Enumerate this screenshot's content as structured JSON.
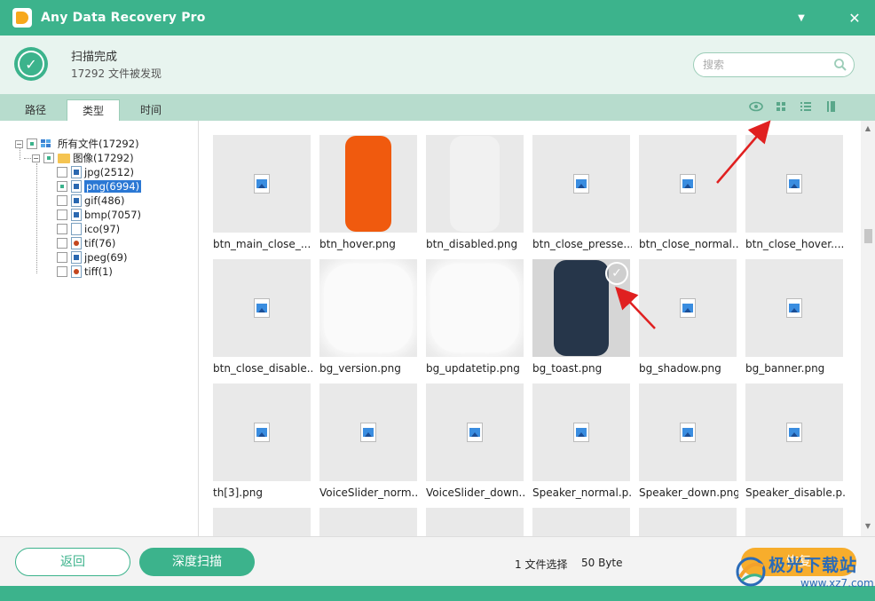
{
  "app": {
    "title": "Any Data Recovery Pro"
  },
  "scan": {
    "title": "扫描完成",
    "count": "17292 文件被发现"
  },
  "search": {
    "placeholder": "搜索",
    "value": ""
  },
  "tabs": [
    {
      "label": "路径"
    },
    {
      "label": "类型"
    },
    {
      "label": "时间"
    }
  ],
  "active_tab": "类型",
  "view_icons": [
    "eye-icon",
    "grid-view-icon",
    "list-view-icon",
    "detail-view-icon"
  ],
  "tree": {
    "root": "所有文件(17292)",
    "folder": "图像(17292)",
    "types": [
      "jpg(2512)",
      "png(6994)",
      "gif(486)",
      "bmp(7057)",
      "ico(97)",
      "tif(76)",
      "jpeg(69)",
      "tiff(1)"
    ],
    "selected": "png(6994)"
  },
  "files": [
    "btn_main_close_...",
    "btn_hover.png",
    "btn_disabled.png",
    "btn_close_presse...",
    "btn_close_normal...",
    "btn_close_hover....",
    "btn_close_disable...",
    "bg_version.png",
    "bg_updatetip.png",
    "bg_toast.png",
    "bg_shadow.png",
    "bg_banner.png",
    "th[3].png",
    "VoiceSlider_norm...",
    "VoiceSlider_down...",
    "Speaker_normal.p...",
    "Speaker_down.png",
    "Speaker_disable.p..."
  ],
  "checked_file": "bg_toast.png",
  "footer": {
    "back_label": "返回",
    "deep_scan_label": "深度扫描",
    "selection": "1 文件选择",
    "size": "50 Byte",
    "recover_label": "恢复"
  },
  "watermark": {
    "text": "极光下载站",
    "url": "www.xz7.com"
  },
  "colors": {
    "accent": "#3cb38c",
    "recover": "#f7ad2c",
    "selection": "#2b78d4",
    "annotation_arrow": "#e02020"
  }
}
